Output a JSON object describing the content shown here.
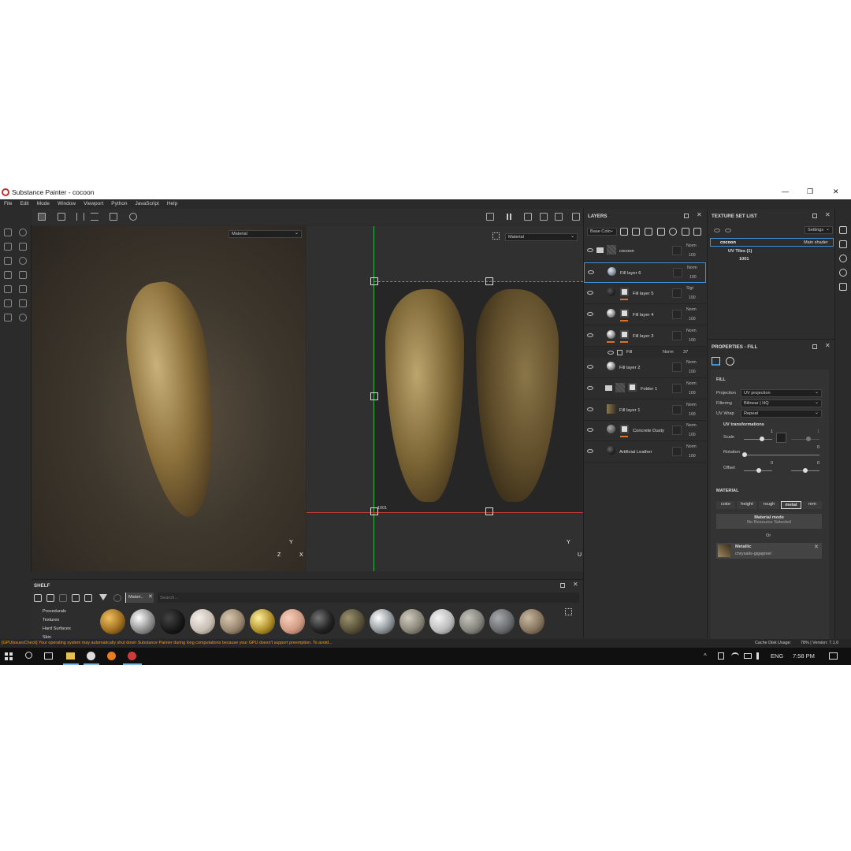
{
  "window": {
    "title": "Substance Painter - cocoon",
    "controls": {
      "minimize": "—",
      "maximize": "❐",
      "close": "✕"
    }
  },
  "menu": [
    "File",
    "Edit",
    "Mode",
    "Window",
    "Viewport",
    "Python",
    "JavaScript",
    "Help"
  ],
  "viewport": {
    "left_mode": "Material",
    "right_mode": "Material",
    "uv_tile_label": "1001",
    "axis_left": {
      "y": "Y",
      "z": "Z",
      "x": "X"
    },
    "axis_right": {
      "y": "Y",
      "u": "U"
    }
  },
  "layers": {
    "title": "LAYERS",
    "channel": "Base Colo",
    "items": [
      {
        "name": "cocoon",
        "blend": "Norm",
        "opacity": "100",
        "type": "folder-top"
      },
      {
        "name": "Fill layer 6",
        "blend": "Norm",
        "opacity": "100",
        "selected": true
      },
      {
        "name": "Fill layer 5",
        "blend": "Slgt",
        "opacity": "100",
        "mask": true
      },
      {
        "name": "Fill layer 4",
        "blend": "Norm",
        "opacity": "100",
        "mask": true
      },
      {
        "name": "Fill layer 3",
        "blend": "Norm",
        "opacity": "100",
        "mask": true
      },
      {
        "name": "Fill layer 2",
        "blend": "Norm",
        "opacity": "100"
      },
      {
        "name": "Folder 1",
        "blend": "Norm",
        "opacity": "100",
        "type": "folder"
      },
      {
        "name": "Fill layer 1",
        "blend": "Norm",
        "opacity": "100"
      },
      {
        "name": "Concrete Dusty",
        "blend": "Norm",
        "opacity": "100",
        "mask": true
      },
      {
        "name": "Artificial Leather",
        "blend": "Norm",
        "opacity": "100"
      }
    ],
    "sub_effect": {
      "name": "Fill",
      "blend": "Norm",
      "opacity": "37"
    }
  },
  "texture_set": {
    "title": "TEXTURE SET LIST",
    "settings": "Settings",
    "set_name": "cocoon",
    "shader": "Main shader",
    "uv_tiles": "UV Tiles (1)",
    "tile": "1001"
  },
  "properties": {
    "title": "PROPERTIES - FILL",
    "fill_header": "FILL",
    "projection_label": "Projection",
    "projection": "UV projection",
    "filtering_label": "Filtering",
    "filtering": "Bilinear | HQ",
    "uvwrap_label": "UV Wrap",
    "uvwrap": "Repeat",
    "uvtrans": "UV transformations",
    "scale_label": "Scale",
    "scale_val": "1",
    "scale_val2": "1",
    "rotation_label": "Rotation",
    "rotation_val": "0",
    "offset_label": "Offset",
    "offset_val1": "0",
    "offset_val2": "0",
    "material_header": "MATERIAL",
    "channels": [
      "color",
      "height",
      "rough",
      "metal",
      "nrm"
    ],
    "material_mode": "Material mode",
    "no_resource": "No Resource Selected",
    "or": "Or",
    "metallic": "Metallic",
    "metallic_res": "chrysalis-gigapixel"
  },
  "shelf": {
    "title": "SHELF",
    "filter_tag": "Materi..",
    "search_placeholder": "Search...",
    "categories": [
      "Procedurals",
      "Textures",
      "Hard Surfaces",
      "Skin"
    ]
  },
  "status": {
    "warning": "[GPUIssuesCheck] Your operating system may automatically shut down Substance Painter during long computations because your GPU doesn't support preemption. To avoid...",
    "cache": "Cache Disk Usage:",
    "version": "78% | Version: 7.1.0"
  },
  "taskbar": {
    "lang": "ENG",
    "time": "7:58 PM"
  },
  "colors": {
    "accent": "#3d8fd6",
    "warning": "#e8a020",
    "mask_orange": "#e07020"
  }
}
